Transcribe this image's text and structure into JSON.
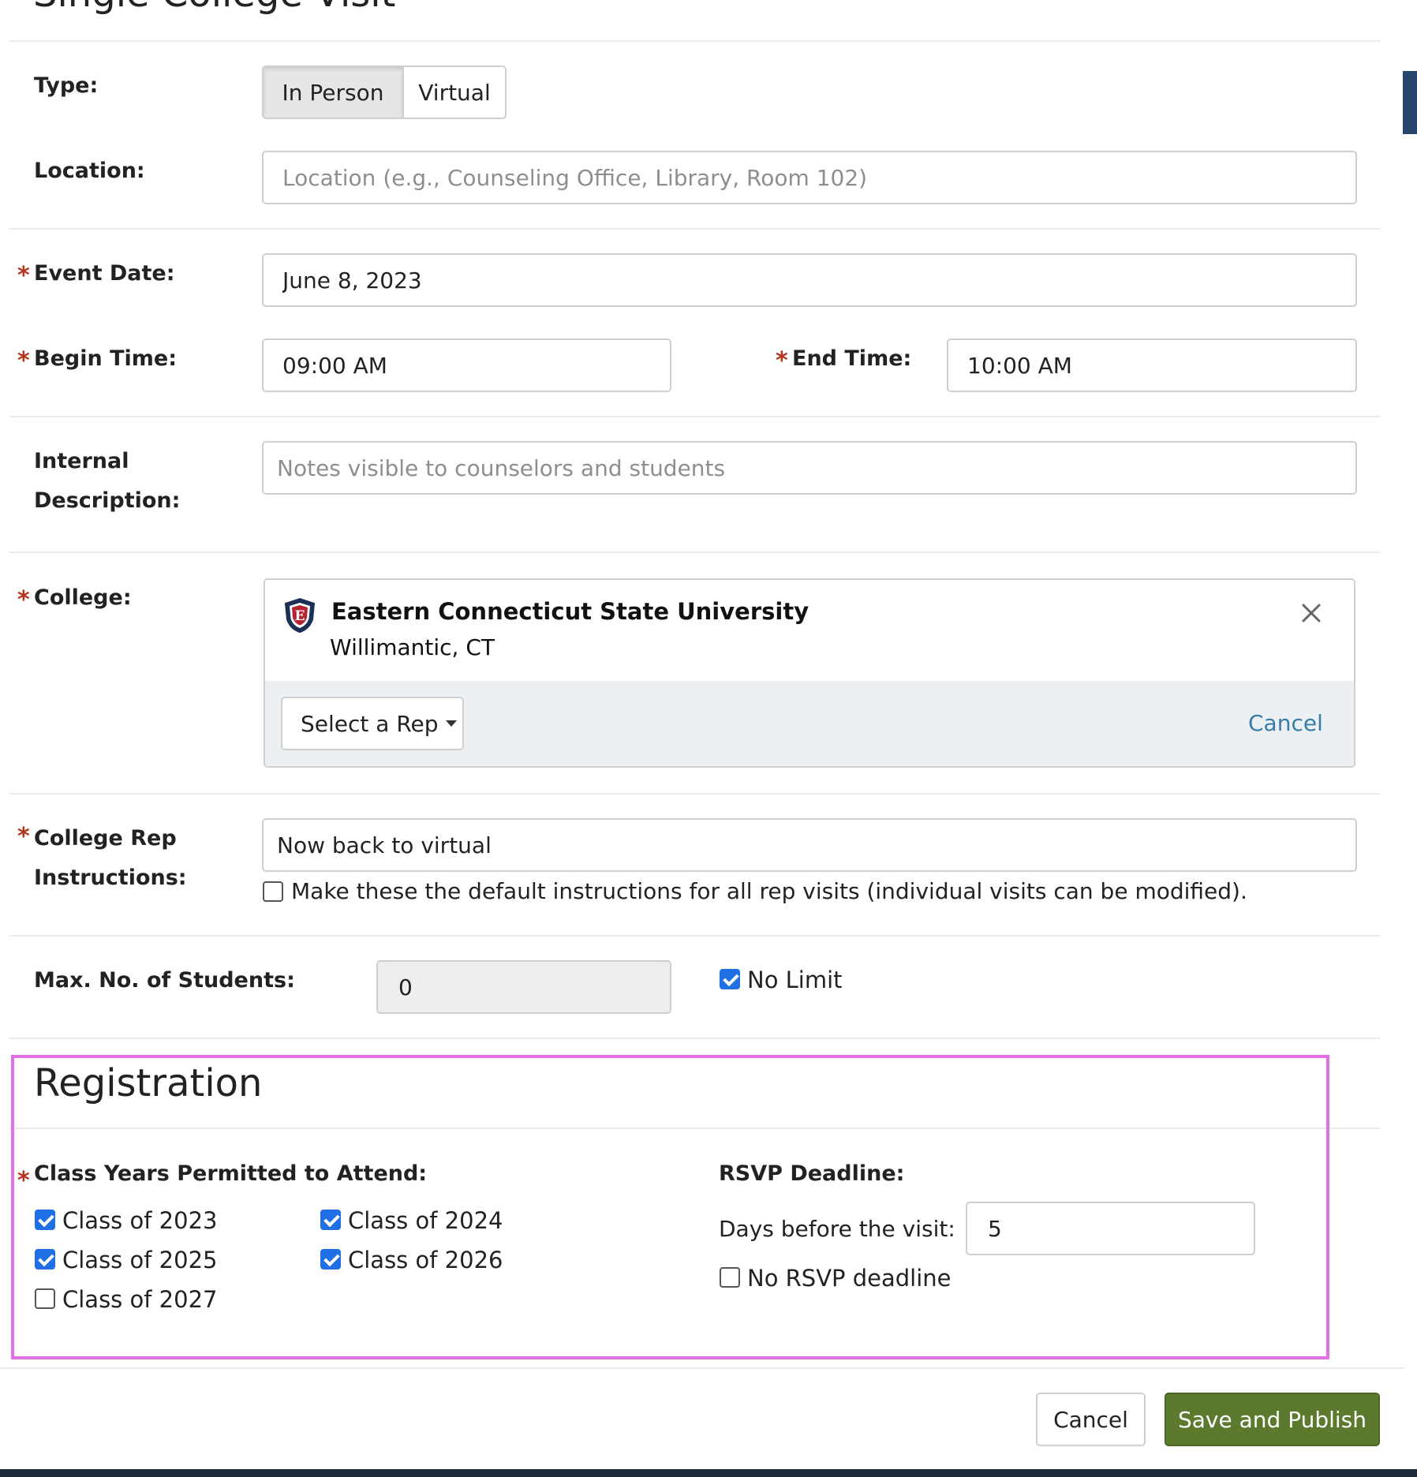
{
  "modal": {
    "title": "Single College Visit"
  },
  "type": {
    "label": "Type:",
    "options": [
      "In Person",
      "Virtual"
    ],
    "selected": "In Person"
  },
  "location": {
    "label": "Location:",
    "placeholder": "Location (e.g., Counseling Office, Library, Room 102)",
    "value": ""
  },
  "event_date": {
    "label": "Event Date:",
    "value": "June 8, 2023"
  },
  "begin_time": {
    "label": "Begin Time:",
    "value": "09:00 AM"
  },
  "end_time": {
    "label": "End Time:",
    "value": "10:00 AM"
  },
  "internal_description": {
    "label_line1": "Internal",
    "label_line2": "Description:",
    "placeholder": "Notes visible to counselors and students",
    "value": ""
  },
  "college": {
    "label": "College:",
    "name": "Eastern Connecticut State University",
    "location": "Willimantic, CT",
    "select_rep_label": "Select a Rep",
    "cancel_label": "Cancel"
  },
  "rep_instructions": {
    "label_line1": "College Rep",
    "label_line2": "Instructions:",
    "value": "Now back to virtual",
    "default_checkbox_label": "Make these the default instructions for all rep visits (individual visits can be modified).",
    "default_checked": false
  },
  "max_students": {
    "label": "Max. No. of Students:",
    "value": "0",
    "no_limit_label": "No Limit",
    "no_limit_checked": true
  },
  "registration": {
    "heading": "Registration",
    "class_years_label": "Class Years Permitted to Attend:",
    "class_years": [
      {
        "label": "Class of 2023",
        "checked": true
      },
      {
        "label": "Class of 2024",
        "checked": true
      },
      {
        "label": "Class of 2025",
        "checked": true
      },
      {
        "label": "Class of 2026",
        "checked": true
      },
      {
        "label": "Class of 2027",
        "checked": false
      }
    ],
    "rsvp_label": "RSVP Deadline:",
    "days_before_label": "Days before the visit:",
    "days_before_value": "5",
    "no_rsvp_label": "No RSVP deadline",
    "no_rsvp_checked": false
  },
  "footer": {
    "cancel_label": "Cancel",
    "save_label": "Save and Publish"
  },
  "colors": {
    "accent_blue": "#1f6fe5",
    "required": "#b5341b",
    "primary_button": "#5c7a2e",
    "highlight_box": "#e36ee6",
    "link": "#3a7ca5"
  }
}
